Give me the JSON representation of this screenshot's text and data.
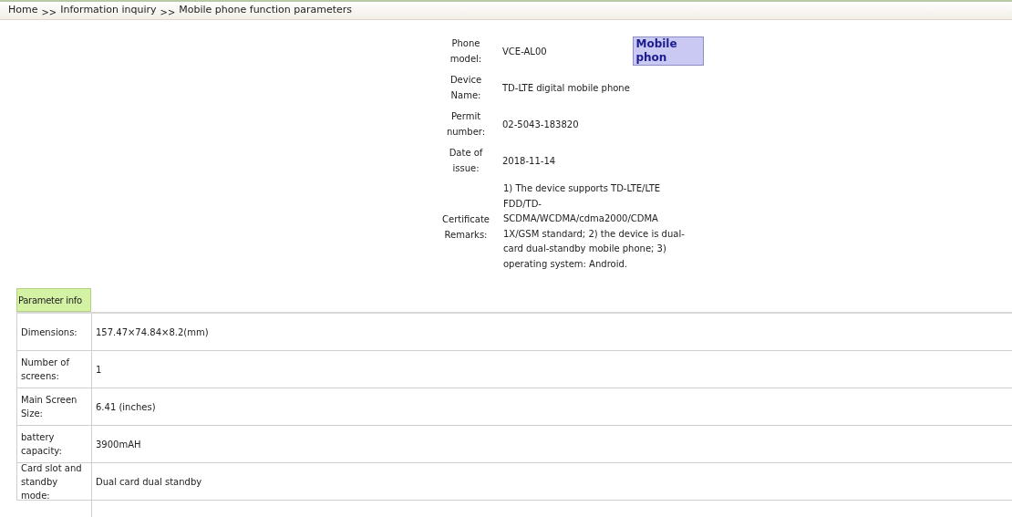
{
  "breadcrumb": [
    {
      "label": "Home",
      "separator": ">>"
    },
    {
      "label": "Information inquiry",
      "separator": ">>"
    },
    {
      "label": "Mobile phone function parameters"
    }
  ],
  "certificate": {
    "rows": [
      {
        "label": "Phone model:",
        "value": "VCE-AL00",
        "tag": "Mobile phon"
      },
      {
        "label": "Device Name:",
        "value": "TD-LTE digital mobile phone"
      },
      {
        "label": "Permit number:",
        "value": "02-5043-183820"
      },
      {
        "label": "Date of issue:",
        "value": "2018-11-14"
      },
      {
        "label": "Certificate Remarks:",
        "value": "1) The device supports TD-LTE/LTE FDD/TD-SCDMA/WCDMA/cdma2000/CDMA 1X/GSM standard; 2) the device is dual-card dual-standby mobile phone; 3) operating system: Android.",
        "kind": "remarks"
      }
    ]
  },
  "parameters": {
    "heading": "Parameter info",
    "rows": [
      {
        "label": "Dimensions:",
        "value": "157.47×74.84×8.2(mm)"
      },
      {
        "label": "Number of screens:",
        "value": "1"
      },
      {
        "label": "Main Screen Size:",
        "value": "6.41 (inches)"
      },
      {
        "label": "battery capacity:",
        "value": "3900mAH"
      },
      {
        "label": "Card slot and standby mode:",
        "value": "Dual card dual standby"
      }
    ]
  }
}
